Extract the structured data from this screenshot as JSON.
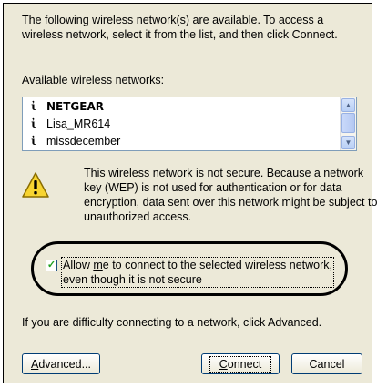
{
  "intro": {
    "line1": "The following wireless network(s) are available. To access a",
    "line2": "wireless network, select it from the list, and then click Connect."
  },
  "available_label": "Available wireless networks:",
  "networks": [
    {
      "name": "NETGEAR",
      "icon": "wireless-antenna-icon"
    },
    {
      "name": "Lisa_MR614",
      "icon": "wireless-antenna-icon"
    },
    {
      "name": "missdecember",
      "icon": "wireless-antenna-icon"
    }
  ],
  "warning": {
    "icon": "warning-icon",
    "line1": "This wireless network is not secure. Because a network",
    "line2": "key (WEP) is not used for authentication or for data",
    "line3": "encryption, data sent over this network might be subject to",
    "line4": "unauthorized access."
  },
  "allow_checkbox": {
    "checked": true,
    "line1_pre": "Allow ",
    "line1_mnemonic": "m",
    "line1_post": "e to connect to the selected wireless network,",
    "line2": "even though it is not secure"
  },
  "help_text": "If you are difficulty connecting to a network, click Advanced.",
  "buttons": {
    "advanced_mnemonic": "A",
    "advanced_rest": "dvanced...",
    "connect_mnemonic": "C",
    "connect_rest": "onnect",
    "cancel": "Cancel"
  },
  "colors": {
    "dialog_bg": "#ece9d8",
    "button_border": "#003c74",
    "listbox_border": "#7f9db9",
    "checkmark": "#21a121"
  }
}
